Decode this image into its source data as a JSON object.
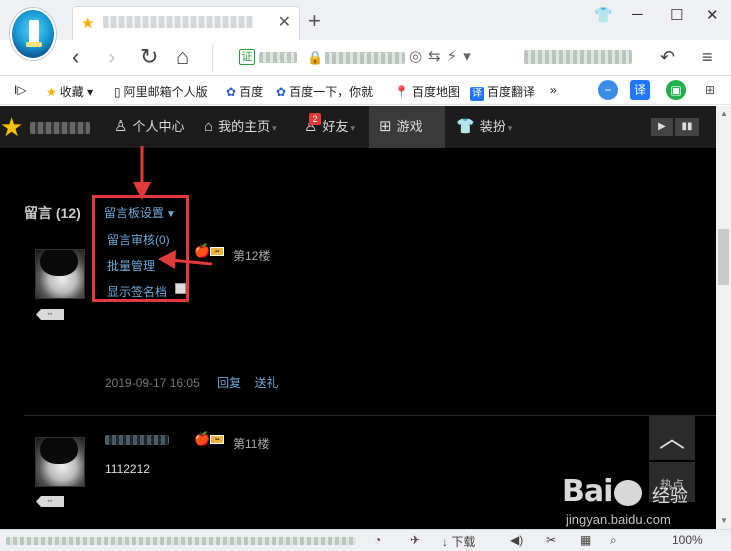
{
  "tab": {
    "close_glyph": "✕",
    "new_tab_glyph": "+"
  },
  "window_controls": {
    "skin": "👕",
    "minimize": "─",
    "maximize": "☐",
    "close": "✕"
  },
  "nav": {
    "back": "‹",
    "forward": "›",
    "refresh": "↻",
    "home": "⌂",
    "cert_label": "证"
  },
  "bookmarks": {
    "toggle": "I▷",
    "items": [
      "收藏",
      "阿里邮箱个人版",
      "百度",
      "百度一下，你就",
      "百度地图",
      "百度翻译"
    ],
    "more": "»",
    "translate_label": "译"
  },
  "site_menu": {
    "items": [
      "个人中心",
      "我的主页",
      "好友",
      "游戏",
      "装扮"
    ],
    "friend_badge": "2",
    "active_item": "游戏"
  },
  "comments": {
    "title": "留言 (12)",
    "settings_toggle": "留言板设置",
    "settings_menu": [
      "留言审核(0)",
      "批量管理",
      "显示签名档"
    ],
    "entries": [
      {
        "floor": "第12楼",
        "text": "",
        "timestamp": "2019-09-17 16:05",
        "actions": [
          "回复",
          "送礼"
        ]
      },
      {
        "floor": "第11楼",
        "text": "1112212"
      }
    ]
  },
  "float_buttons": {
    "top_label": "︿",
    "hot_label": "热点"
  },
  "status_bar": {
    "download": "下载",
    "zoom": "100%"
  },
  "watermark": {
    "brand": "Bai",
    "jingyan": "经验",
    "url": "jingyan.baidu.com"
  },
  "colors": {
    "highlight": "#e23a3a",
    "link": "#6fa6d6",
    "site_bg": "#000000",
    "header_bg": "#1c1c1c"
  }
}
